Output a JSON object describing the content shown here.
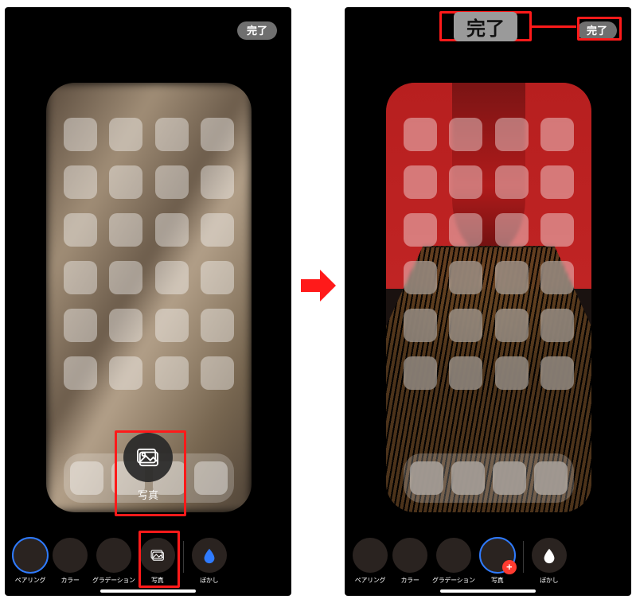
{
  "done_label": "完了",
  "popup": {
    "label": "写真"
  },
  "options": [
    {
      "key": "pairing",
      "label": "ペアリング"
    },
    {
      "key": "color",
      "label": "カラー"
    },
    {
      "key": "gradient",
      "label": "グラデーション"
    },
    {
      "key": "photo",
      "label": "写真"
    },
    {
      "key": "blur",
      "label": "ぼかし"
    }
  ],
  "left": {
    "selected_option": "pairing"
  },
  "right": {
    "selected_option": "photo"
  },
  "callout_done_label": "完了",
  "highlight_color": "#ff1a1a",
  "grid": {
    "rows": 6,
    "cols": 4,
    "dock_cols": 4
  }
}
